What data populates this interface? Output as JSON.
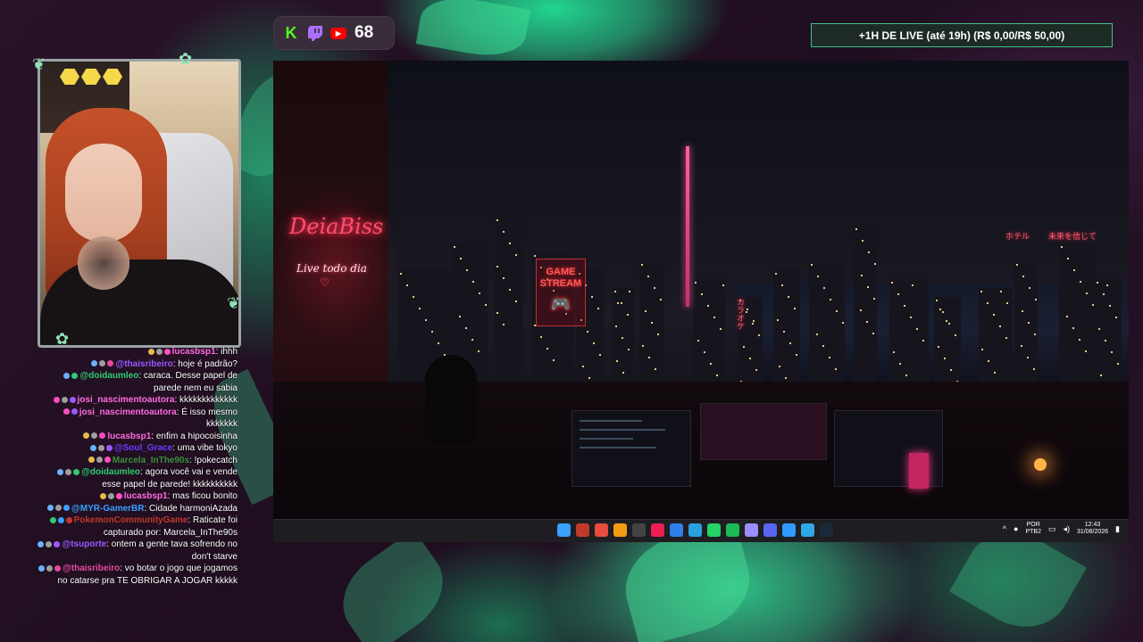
{
  "platforms": {
    "kick_icon": "K",
    "twitch_icon": "twitch-glyph",
    "youtube_icon": "▶",
    "viewer_count": "68"
  },
  "live_goal": "+1H DE LIVE (até 19h) (R$ 0,00/R$ 50,00)",
  "stream_scene": {
    "neon_title": "DeiaBiss",
    "neon_subtitle": "Live todo dia",
    "neon_heart": "♡",
    "game_sign": "GAME STREAM",
    "gamepad": "🎮",
    "jp_sign_1": "ホテル",
    "jp_sign_2": "未来を信じて",
    "jp_sign_3": "カラオケ"
  },
  "taskbar": {
    "lang_top": "POR",
    "lang_bottom": "PTB2",
    "time": "12:43",
    "date": "31/08/2026",
    "icons": [
      "#3aa0ff",
      "#c0392b",
      "#e74c3c",
      "#f39c12",
      "#444",
      "#ee1d52",
      "#2f80ed",
      "#2aa1e0",
      "#25d366",
      "#1db954",
      "#9b8cff",
      "#5865f2",
      "#2f9bff",
      "#2ea8e6",
      "#1b2838"
    ]
  },
  "chat": [
    {
      "user": "lucasbsp1",
      "text": "ihhh",
      "color": "#ff6adf",
      "badges": [
        "#e8b84a",
        "#9e9e9e",
        "#ff4fbf"
      ]
    },
    {
      "user": "@thaisribeiro",
      "text": "hoje é padrão?",
      "color": "#9b59ff",
      "badges": [
        "#6ab0ff",
        "#9e9e9e",
        "#e64aa0"
      ]
    },
    {
      "user": "@doidaumleo",
      "text": "caraca. Desse papel de parede nem eu sabia",
      "color": "#2ecc71",
      "badges": [
        "#6ab0ff",
        "#2ecc71"
      ]
    },
    {
      "user": "josi_nascimentoautora",
      "text": "kkkkkkkkkkkkk",
      "color": "#ff6adf",
      "badges": [
        "#ff4fbf",
        "#9e9e9e",
        "#9b59ff"
      ]
    },
    {
      "user": "josi_nascimentoautora",
      "text": "É isso mesmo kkkkkkk",
      "color": "#ff6adf",
      "badges": [
        "#ff4fbf",
        "#9b59ff"
      ]
    },
    {
      "user": "lucasbsp1",
      "text": "enfim a hipocoisinha",
      "color": "#ff6adf",
      "badges": [
        "#e8b84a",
        "#9e9e9e",
        "#ff4fbf"
      ]
    },
    {
      "user": "@Soul_Grace",
      "text": "uma vibe tokyo",
      "color": "#6a3cff",
      "badges": [
        "#6ab0ff",
        "#9e9e9e",
        "#9b59ff"
      ]
    },
    {
      "user": "Marcela_InThe90s",
      "text": "!pokecatch",
      "color": "#3a8f3a",
      "badges": [
        "#e8b84a",
        "#9e9e9e",
        "#ff4fbf"
      ]
    },
    {
      "user": "@doidaumleo",
      "text": "agora você vai e vende esse papel de parede! kkkkkkkkkk",
      "color": "#2ecc71",
      "badges": [
        "#6ab0ff",
        "#9e9e9e",
        "#2ecc71"
      ]
    },
    {
      "user": "lucasbsp1",
      "text": "mas ficou bonito",
      "color": "#ff6adf",
      "badges": [
        "#e8b84a",
        "#9e9e9e",
        "#ff4fbf"
      ]
    },
    {
      "user": "@MYR-GamerBR",
      "text": "Cidade harmoniAzada",
      "color": "#3aa0ff",
      "badges": [
        "#6ab0ff",
        "#9e9e9e",
        "#3aa0ff"
      ]
    },
    {
      "user": "PokemonCommunityGame",
      "text": "Raticate foi capturado por: Marcela_InThe90s",
      "color": "#c0392b",
      "badges": [
        "#2ecc71",
        "#3aa0ff",
        "#c0392b"
      ]
    },
    {
      "user": "@tsuporte",
      "text": "ontem a gente tava sofrendo no don't starve",
      "color": "#9b59ff",
      "badges": [
        "#6ab0ff",
        "#9e9e9e",
        "#9b59ff"
      ]
    },
    {
      "user": "@thaisribeiro",
      "text": "vo botar o jogo que jogamos no catarse pra TE OBRIGAR A JOGAR kkkkk",
      "color": "#e64aa0",
      "badges": [
        "#6ab0ff",
        "#9e9e9e",
        "#e64aa0"
      ]
    }
  ]
}
